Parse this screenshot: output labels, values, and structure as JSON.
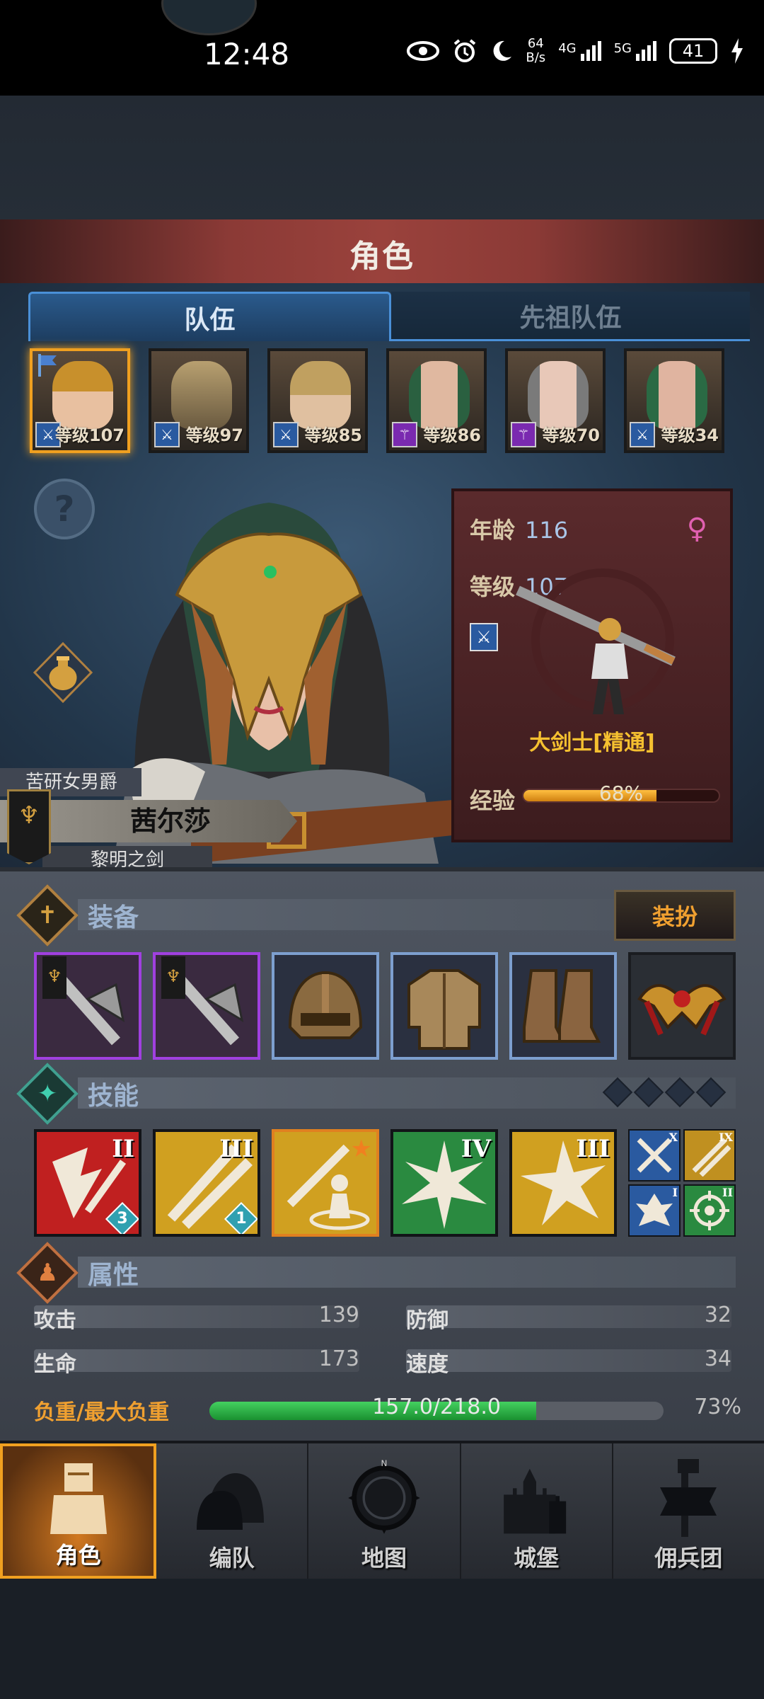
{
  "status_bar": {
    "time": "12:48",
    "net_speed_top": "64",
    "net_speed_unit": "B/s",
    "signal1_label": "4G",
    "signal2_label": "5G",
    "battery": "41"
  },
  "screen": {
    "title": "角色",
    "tabs": [
      {
        "label": "队伍",
        "active": true
      },
      {
        "label": "先祖队伍",
        "active": false
      }
    ]
  },
  "roster": [
    {
      "level": "等级107",
      "class_icon": "sword-icon",
      "selected": true,
      "hair": "#c8902c"
    },
    {
      "level": "等级97",
      "class_icon": "sword-icon",
      "selected": false,
      "hair": "#b8a070"
    },
    {
      "level": "等级85",
      "class_icon": "sword-icon",
      "selected": false,
      "hair": "#c0a060"
    },
    {
      "level": "等级86",
      "class_icon": "staff-icon",
      "selected": false,
      "hair": "#2a6040"
    },
    {
      "level": "等级70",
      "class_icon": "staff-icon",
      "selected": false,
      "hair": "#7a7a7a"
    },
    {
      "level": "等级34",
      "class_icon": "sword-icon",
      "selected": false,
      "hair": "#2a6a44"
    }
  ],
  "character": {
    "title": "苦研女男爵",
    "name": "茜尔莎",
    "epithet": "黎明之剑",
    "age_label": "年龄",
    "age": "116",
    "level_label": "等级",
    "level": "107",
    "class_name": "大剑士[精通]",
    "exp_label": "经验",
    "exp_text": "68%",
    "exp_fraction": 0.68,
    "gender_icon": "female-icon"
  },
  "sections": {
    "equipment": "装备",
    "dress_button": "装扮",
    "skills": "技能",
    "attributes": "属性"
  },
  "equipment": [
    {
      "name": "axe-banner-icon",
      "rarity": "epic"
    },
    {
      "name": "axe-banner-icon",
      "rarity": "epic"
    },
    {
      "name": "helmet-icon",
      "rarity": "rare"
    },
    {
      "name": "armor-icon",
      "rarity": "rare"
    },
    {
      "name": "boots-icon",
      "rarity": "rare"
    },
    {
      "name": "amulet-icon",
      "rarity": "common"
    }
  ],
  "skills": [
    {
      "rank": "II",
      "badge": "3",
      "color": "#c02020"
    },
    {
      "rank": "III",
      "badge": "1",
      "color": "#d0a020"
    },
    {
      "rank": "",
      "badge": "",
      "color": "#d0a020"
    },
    {
      "rank": "IV",
      "badge": "",
      "color": "#2a8a40"
    },
    {
      "rank": "III",
      "badge": "",
      "color": "#d0a020"
    }
  ],
  "passive_skills": [
    {
      "rank": "X",
      "color": "#2a5aa0"
    },
    {
      "rank": "IX",
      "color": "#c09020"
    },
    {
      "rank": "I",
      "color": "#2a5aa0"
    },
    {
      "rank": "II",
      "color": "#2a8a40"
    }
  ],
  "attributes": {
    "attack_label": "攻击",
    "attack": "139",
    "defense_label": "防御",
    "defense": "32",
    "hp_label": "生命",
    "hp": "173",
    "speed_label": "速度",
    "speed": "34",
    "load_label": "负重/最大负重",
    "load_text": "157.0/218.0",
    "load_fraction": 0.72,
    "load_pct": "73%"
  },
  "navbar": [
    {
      "label": "角色",
      "active": true
    },
    {
      "label": "编队",
      "active": false
    },
    {
      "label": "地图",
      "active": false
    },
    {
      "label": "城堡",
      "active": false
    },
    {
      "label": "佣兵团",
      "active": false
    }
  ],
  "colors": {
    "accent": "#f0a020",
    "tab_blue": "#4a90d8",
    "epic_purple": "#a040e0",
    "rare_blue": "#7d9fcf"
  }
}
